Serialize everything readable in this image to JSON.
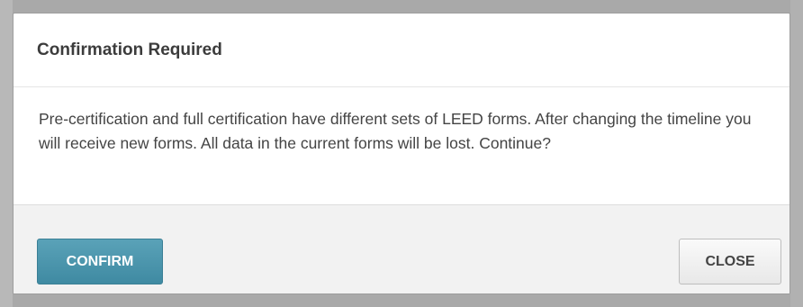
{
  "dialog": {
    "title": "Confirmation Required",
    "message": "Pre-certification and full certification have different sets of LEED forms. After changing the timeline you will receive new forms. All data in the current forms will be lost. Continue?",
    "confirm_label": "CONFIRM",
    "close_label": "CLOSE"
  },
  "colors": {
    "confirm_button": "#4a93aa",
    "close_button": "#ededed",
    "footer_background": "#f2f2f2",
    "title_text": "#3c3c3c"
  }
}
